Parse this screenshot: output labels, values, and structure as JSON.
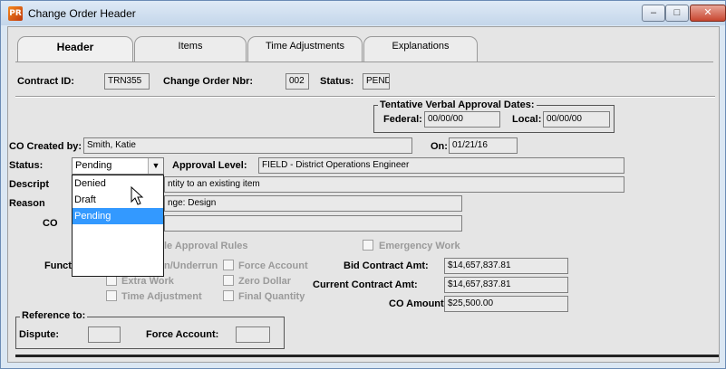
{
  "window": {
    "title": "Change Order Header",
    "app_icon": "PR"
  },
  "window_buttons": {
    "minimize": "–",
    "maximize": "□",
    "close": "✕"
  },
  "tabs": [
    {
      "label": "Header"
    },
    {
      "label": "Items"
    },
    {
      "label": "Time Adjustments"
    },
    {
      "label": "Explanations"
    }
  ],
  "header": {
    "contract_id_label": "Contract ID:",
    "contract_id": "TRN355",
    "co_nbr_label": "Change Order Nbr:",
    "co_nbr": "002",
    "status_label": "Status:",
    "status": "PEND"
  },
  "tentative": {
    "title": "Tentative Verbal Approval Dates:",
    "federal_label": "Federal:",
    "federal": "00/00/00",
    "local_label": "Local:",
    "local": "00/00/00"
  },
  "created_by": {
    "label": "CO Created by:",
    "value": "Smith, Katie",
    "on_label": "On:",
    "on_value": "01/21/16"
  },
  "status_row": {
    "label": "Status:",
    "selected": "Pending",
    "options": [
      "Denied",
      "Draft",
      "Pending"
    ],
    "approval_label": "Approval Level:",
    "approval_value": "FIELD - District Operations Engineer"
  },
  "description": {
    "label": "Descript",
    "value": "ntity to an existing item"
  },
  "reason": {
    "label": "Reason",
    "value": "nge: Design"
  },
  "co_row": {
    "label": "CO"
  },
  "approval_rules": {
    "label": "le Approval Rules"
  },
  "emergency": {
    "label": "Emergency Work"
  },
  "function": {
    "label": "Funct",
    "overrun_label": "n/Underrun",
    "force_account_label": "Force Account",
    "extra_work_label": "Extra Work",
    "zero_dollar_label": "Zero Dollar",
    "time_adj_label": "Time Adjustment",
    "final_qty_label": "Final Quantity"
  },
  "amounts": {
    "bid_label": "Bid Contract Amt:",
    "bid": "$14,657,837.81",
    "current_label": "Current Contract Amt:",
    "current": "$14,657,837.81",
    "co_label": "CO Amount:",
    "co": "$25,500.00"
  },
  "reference": {
    "title": "Reference to:",
    "dispute_label": "Dispute:",
    "dispute": "",
    "force_account_label": "Force Account:",
    "force_account": ""
  },
  "colors": {
    "selection": "#3399ff",
    "panel": "#e5e5e5",
    "titlebar": "#c4d6ea"
  }
}
